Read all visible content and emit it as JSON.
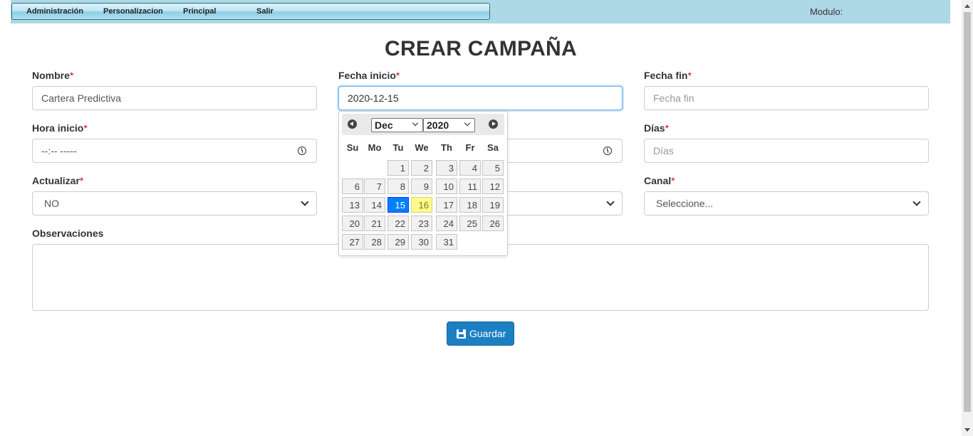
{
  "menu": {
    "items": [
      "Administración",
      "Personalizacion",
      "Principal",
      "Salir"
    ]
  },
  "modulo_label": "Modulo:",
  "page_title": "CREAR CAMPAÑA",
  "required_mark": "*",
  "fields": {
    "nombre": {
      "label": "Nombre",
      "value": "Cartera Predictiva"
    },
    "fecha_inicio": {
      "label": "Fecha inicio",
      "value": "2020-12-15"
    },
    "fecha_fin": {
      "label": "Fecha fin",
      "placeholder": "Fecha fin"
    },
    "hora_inicio": {
      "label": "Hora inicio",
      "value": "--:-- -----"
    },
    "dias": {
      "label": "Días",
      "placeholder": "Días"
    },
    "actualizar": {
      "label": "Actualizar",
      "value": "NO"
    },
    "canal": {
      "label": "Canal",
      "value": "Seleccione..."
    },
    "observaciones": {
      "label": "Observaciones"
    }
  },
  "save_button": "Guardar",
  "datepicker": {
    "month": "Dec",
    "year": "2020",
    "weekdays": [
      "Su",
      "Mo",
      "Tu",
      "We",
      "Th",
      "Fr",
      "Sa"
    ],
    "weeks": [
      [
        "",
        "",
        "1",
        "2",
        "3",
        "4",
        "5"
      ],
      [
        "6",
        "7",
        "8",
        "9",
        "10",
        "11",
        "12"
      ],
      [
        "13",
        "14",
        "15",
        "16",
        "17",
        "18",
        "19"
      ],
      [
        "20",
        "21",
        "22",
        "23",
        "24",
        "25",
        "26"
      ],
      [
        "27",
        "28",
        "29",
        "30",
        "31",
        "",
        ""
      ]
    ],
    "selected_day": "15",
    "today_day": "16"
  },
  "colors": {
    "topbar": "#add8e6",
    "button": "#1b7fc1",
    "selected_day": "#007fff",
    "today_day": "#fffa90",
    "required": "#dd0000"
  }
}
